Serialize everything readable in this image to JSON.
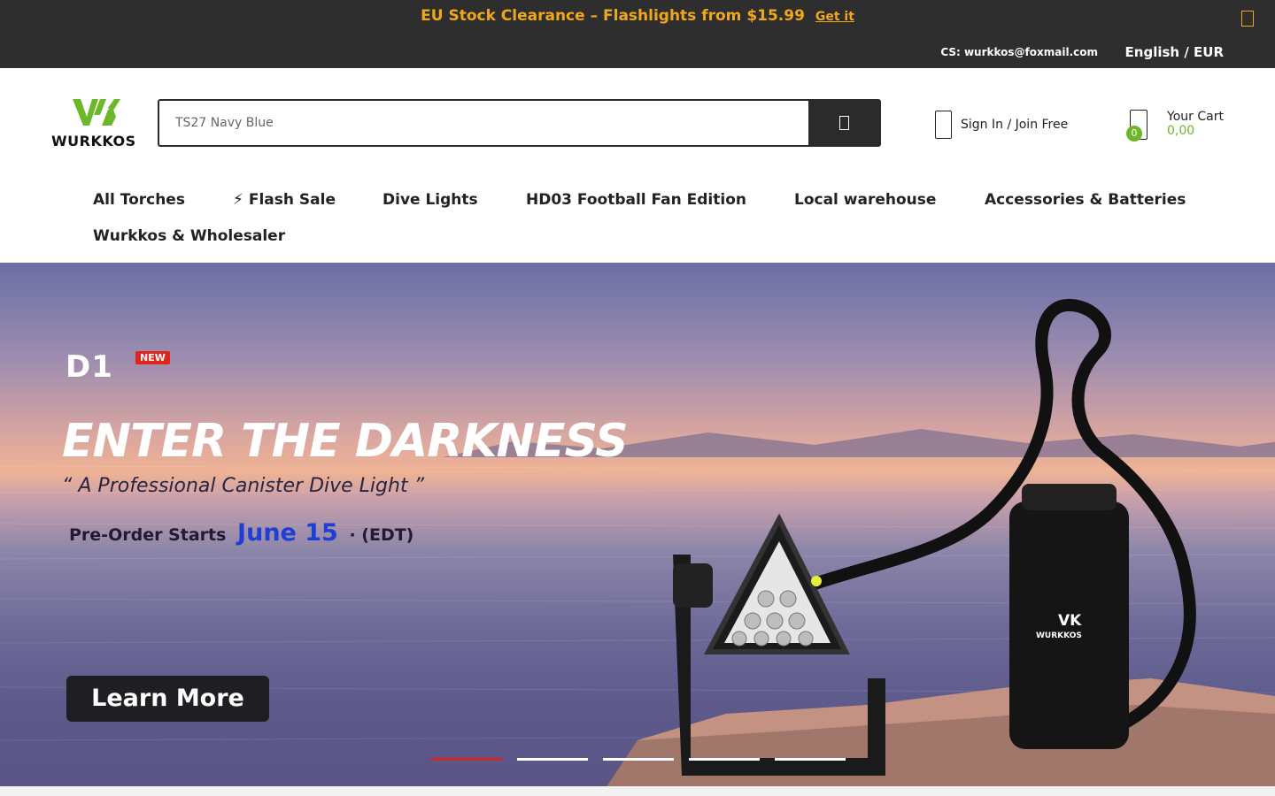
{
  "announcement": {
    "text": "EU Stock Clearance – Flashlights from $15.99",
    "link": "Get it",
    "close_icon": "close-icon"
  },
  "utility": {
    "cs": "CS: wurkkos@foxmail.com",
    "language": "English / EUR"
  },
  "header": {
    "logo_text": "WURKKOS",
    "search_placeholder": "TS27 Navy Blue",
    "search_icon": "search-icon",
    "signin": "Sign In / Join Free",
    "cart_label": "Your Cart",
    "cart_total": "0,00",
    "cart_count": "0"
  },
  "nav": [
    {
      "label": "All Torches"
    },
    {
      "label": "⚡ Flash Sale"
    },
    {
      "label": "Dive Lights"
    },
    {
      "label": "HD03 Football Fan Edition"
    },
    {
      "label": "Local warehouse"
    },
    {
      "label": "Accessories & Batteries"
    },
    {
      "label": "Wurkkos & Wholesaler"
    }
  ],
  "hero": {
    "model": "D1",
    "badge": "NEW",
    "title": "ENTER THE DARKNESS",
    "subtitle": "“ A Professional Canister Dive Light ”",
    "preorder_prefix": "Pre-Order Starts",
    "preorder_date": "June 15",
    "preorder_suffix": "· (EDT)",
    "cta": "Learn More",
    "product_brand": "WURKKOS",
    "slides": 5,
    "active_slide": 1
  },
  "colors": {
    "accent_orange": "#f0a81a",
    "brand_green": "#6db82a",
    "dark": "#2e2e2e",
    "date_blue": "#1d3fd6",
    "slide_active": "#d0262a"
  }
}
